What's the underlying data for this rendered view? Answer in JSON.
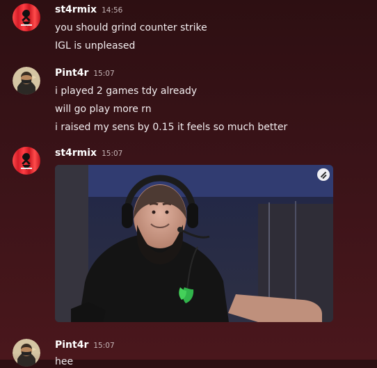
{
  "messages": [
    {
      "author": "st4rmix",
      "timestamp": "14:56",
      "lines": [
        "you should grind counter strike",
        "IGL is unpleased"
      ]
    },
    {
      "author": "Pint4r",
      "timestamp": "15:07",
      "lines": [
        "i played 2 games tdy already",
        "will go play more rn",
        "i raised my sens by 0.15 it feels so much better"
      ]
    },
    {
      "author": "st4rmix",
      "timestamp": "15:07",
      "attachment": {
        "type": "image",
        "icon": "gif-badge-icon"
      }
    },
    {
      "author": "Pint4r",
      "timestamp": "15:07",
      "lines": [
        "hee"
      ]
    }
  ]
}
